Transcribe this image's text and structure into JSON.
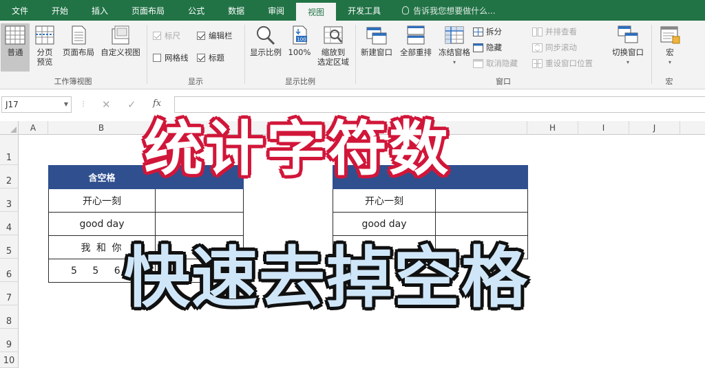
{
  "tabs": [
    {
      "label": "文件"
    },
    {
      "label": "开始"
    },
    {
      "label": "插入"
    },
    {
      "label": "页面布局"
    },
    {
      "label": "公式"
    },
    {
      "label": "数据"
    },
    {
      "label": "审阅"
    },
    {
      "label": "视图",
      "active": true
    },
    {
      "label": "开发工具"
    }
  ],
  "tell_me": "告诉我您想要做什么...",
  "ribbon": {
    "workbook_views": {
      "label": "工作簿视图",
      "normal": "普通",
      "page_break": "分页\n预览",
      "page_layout": "页面布局",
      "custom_views": "自定义视图"
    },
    "show": {
      "label": "显示",
      "ruler": "标尺",
      "gridlines": "网格线",
      "formula_bar": "编辑栏",
      "headings": "标题"
    },
    "zoom": {
      "label": "显示比例",
      "zoom": "显示比例",
      "hundred": "100%",
      "hundred_badge": "100",
      "zoom_selection": "缩放到\n选定区域"
    },
    "window": {
      "label": "窗口",
      "new_window": "新建窗口",
      "arrange_all": "全部重排",
      "freeze_panes": "冻结窗格",
      "split": "拆分",
      "hide": "隐藏",
      "unhide": "取消隐藏",
      "side_by_side": "并排查看",
      "sync_scroll": "同步滚动",
      "reset_position": "重设窗口位置",
      "switch_windows": "切换窗口"
    },
    "macros": {
      "label": "宏",
      "macros": "宏"
    }
  },
  "formula_bar": {
    "name_box": "J17",
    "fx": "fx",
    "value": ""
  },
  "columns": [
    "A",
    "B",
    "",
    "",
    "E",
    "",
    "",
    "H",
    "I",
    "J"
  ],
  "rows": [
    "1",
    "2",
    "3",
    "4",
    "5",
    "6",
    "7",
    "8",
    "9",
    "10"
  ],
  "table_left": {
    "header": [
      "含空格",
      ""
    ],
    "rows": [
      [
        "开心一刻",
        ""
      ],
      [
        "good day",
        ""
      ],
      [
        "我 和 你",
        ""
      ],
      [
        "5 5 6",
        ""
      ]
    ]
  },
  "table_right": {
    "header": [
      "",
      ""
    ],
    "rows": [
      [
        "开心一刻",
        ""
      ],
      [
        "good day",
        ""
      ],
      [
        "",
        ""
      ]
    ]
  },
  "captions": {
    "title": "统计字符数",
    "subtitle": "快速去掉空格"
  },
  "colors": {
    "ribbon_green": "#217346",
    "header_blue": "#2f4f8f",
    "title_outline": "#d1173a",
    "subtitle_fill": "#cfe6f8"
  }
}
